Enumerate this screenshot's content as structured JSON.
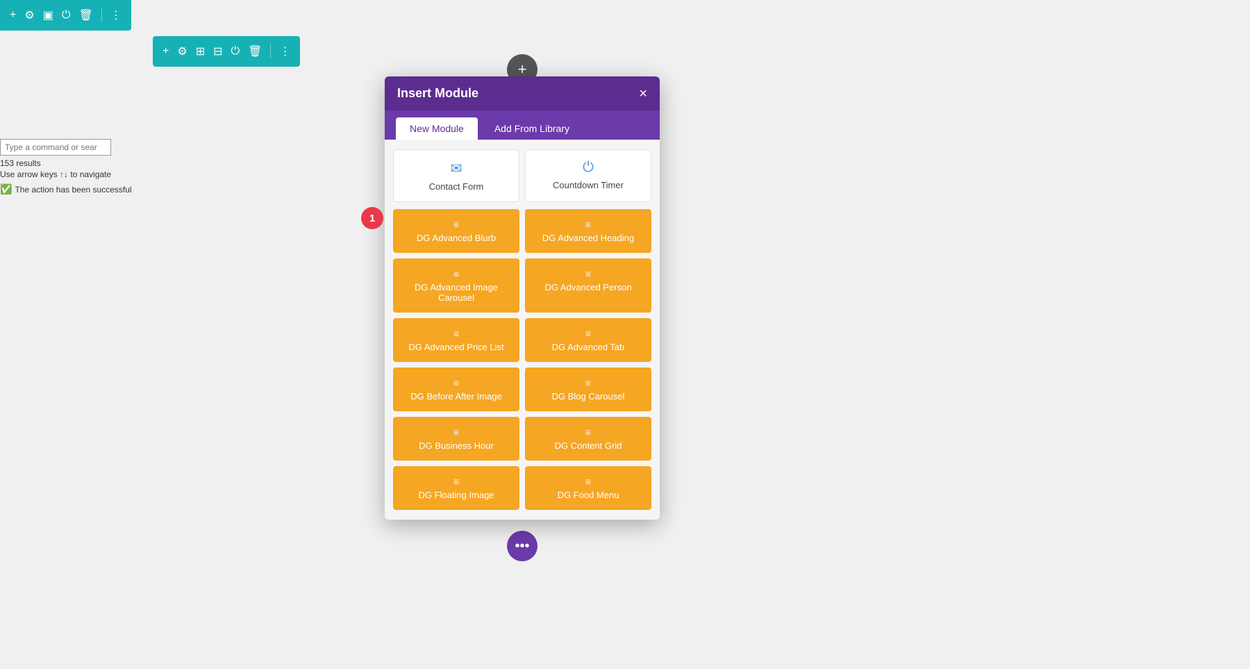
{
  "topToolbar": {
    "buttons": [
      {
        "name": "add",
        "icon": "+"
      },
      {
        "name": "settings",
        "icon": "⚙"
      },
      {
        "name": "layout",
        "icon": "▣"
      },
      {
        "name": "power",
        "icon": "⏻"
      },
      {
        "name": "delete",
        "icon": "🗑"
      },
      {
        "name": "more",
        "icon": "⋮"
      }
    ]
  },
  "secondToolbar": {
    "buttons": [
      {
        "name": "add",
        "icon": "+"
      },
      {
        "name": "settings",
        "icon": "⚙"
      },
      {
        "name": "columns",
        "icon": "⊞"
      },
      {
        "name": "grid",
        "icon": "⊟"
      },
      {
        "name": "power",
        "icon": "⏻"
      },
      {
        "name": "delete",
        "icon": "🗑"
      },
      {
        "name": "more",
        "icon": "⋮"
      }
    ]
  },
  "leftPanel": {
    "searchPlaceholder": "Type a command or sear",
    "resultsText": "153 results",
    "navHint": "Use arrow keys ↑↓ to navigate",
    "successMessage": "The action has been successful"
  },
  "modal": {
    "title": "Insert Module",
    "closeLabel": "×",
    "tabs": [
      {
        "id": "new-module",
        "label": "New Module",
        "active": true
      },
      {
        "id": "add-from-library",
        "label": "Add From Library",
        "active": false
      }
    ],
    "whiteModules": [
      {
        "id": "contact-form",
        "label": "Contact Form",
        "iconType": "email"
      },
      {
        "id": "countdown-timer",
        "label": "Countdown Timer",
        "iconType": "power"
      }
    ],
    "orangeModules": [
      {
        "id": "dg-advanced-blurb",
        "label": "DG Advanced Blurb"
      },
      {
        "id": "dg-advanced-heading",
        "label": "DG Advanced Heading"
      },
      {
        "id": "dg-advanced-image-carousel",
        "label": "DG Advanced Image Carousel"
      },
      {
        "id": "dg-advanced-person",
        "label": "DG Advanced Person"
      },
      {
        "id": "dg-advanced-price-list",
        "label": "DG Advanced Price List"
      },
      {
        "id": "dg-advanced-tab",
        "label": "DG Advanced Tab"
      },
      {
        "id": "dg-before-after-image",
        "label": "DG Before After Image"
      },
      {
        "id": "dg-blog-carousel",
        "label": "DG Blog Carousel"
      },
      {
        "id": "dg-business-hour",
        "label": "DG Business Hour"
      },
      {
        "id": "dg-content-grid",
        "label": "DG Content Grid"
      },
      {
        "id": "dg-floating-image",
        "label": "DG Floating Image"
      },
      {
        "id": "dg-food-menu",
        "label": "DG Food Menu"
      }
    ]
  },
  "badge": {
    "number": "1"
  },
  "addBtnTop": {
    "icon": "+"
  },
  "bottomBtn": {
    "icon": "•••"
  },
  "colors": {
    "teal": "#16b1b5",
    "purple": "#5c2d8f",
    "orange": "#f5a623",
    "red": "#e8394b"
  }
}
